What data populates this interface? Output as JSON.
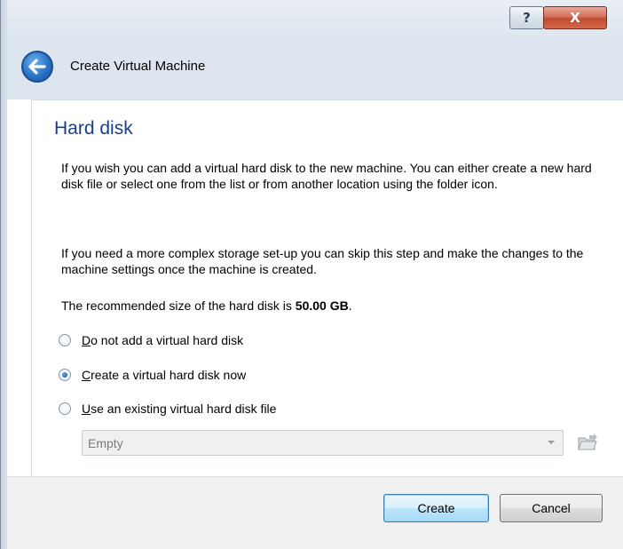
{
  "window": {
    "help_glyph": "?",
    "close_glyph": "X"
  },
  "header": {
    "title": "Create Virtual Machine",
    "back_icon": "back-arrow-icon"
  },
  "page": {
    "title": "Hard disk",
    "paragraph1": "If you wish you can add a virtual hard disk to the new machine. You can either create a new hard disk file or select one from the list or from another location using the folder icon.",
    "paragraph2": "If you need a more complex storage set-up you can skip this step and make the changes to the machine settings once the machine is created.",
    "recommended_prefix": "The recommended size of the hard disk is ",
    "recommended_size": "50.00 GB",
    "recommended_suffix": "."
  },
  "options": [
    {
      "mnemonic": "D",
      "rest": "o not add a virtual hard disk",
      "checked": false
    },
    {
      "mnemonic": "C",
      "rest": "reate a virtual hard disk now",
      "checked": true
    },
    {
      "mnemonic": "U",
      "rest": "se an existing virtual hard disk file",
      "checked": false
    }
  ],
  "existing_disk_select": {
    "value": "Empty",
    "folder_icon": "folder-icon"
  },
  "footer": {
    "create_label": "Create",
    "cancel_label": "Cancel"
  },
  "colors": {
    "title_blue": "#1a3e8c",
    "header_bg": "#dde6ef",
    "close_red": "#c14a2f"
  }
}
